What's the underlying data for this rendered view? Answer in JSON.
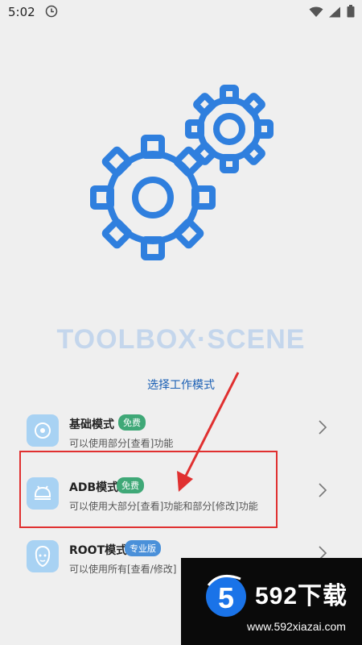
{
  "status_bar": {
    "time": "5:02",
    "icons": [
      "clock-icon",
      "wifi-icon",
      "signal-icon",
      "battery-icon"
    ]
  },
  "hero": {
    "icon": "gears-icon",
    "accent_color": "#2f7fde"
  },
  "brand": {
    "title": "TOOLBOX·SCENE"
  },
  "prompt": {
    "label": "选择工作模式"
  },
  "modes": [
    {
      "title": "基础模式",
      "badge": "免费",
      "desc": "可以使用部分[查看]功能",
      "icon": "disc-icon"
    },
    {
      "title": "ADB模式",
      "badge": "免费",
      "desc": "可以使用大部分[查看]功能和部分[修改]功能",
      "icon": "android-icon"
    },
    {
      "title": "ROOT模式",
      "badge": "专业版",
      "desc": "可以使用所有[查看/修改]",
      "icon": "lion-icon"
    }
  ],
  "watermark": {
    "title": "592下载",
    "url": "www.592xiazai.com",
    "logo_text": "5"
  },
  "annotation": {
    "highlight_color": "#e03030"
  }
}
